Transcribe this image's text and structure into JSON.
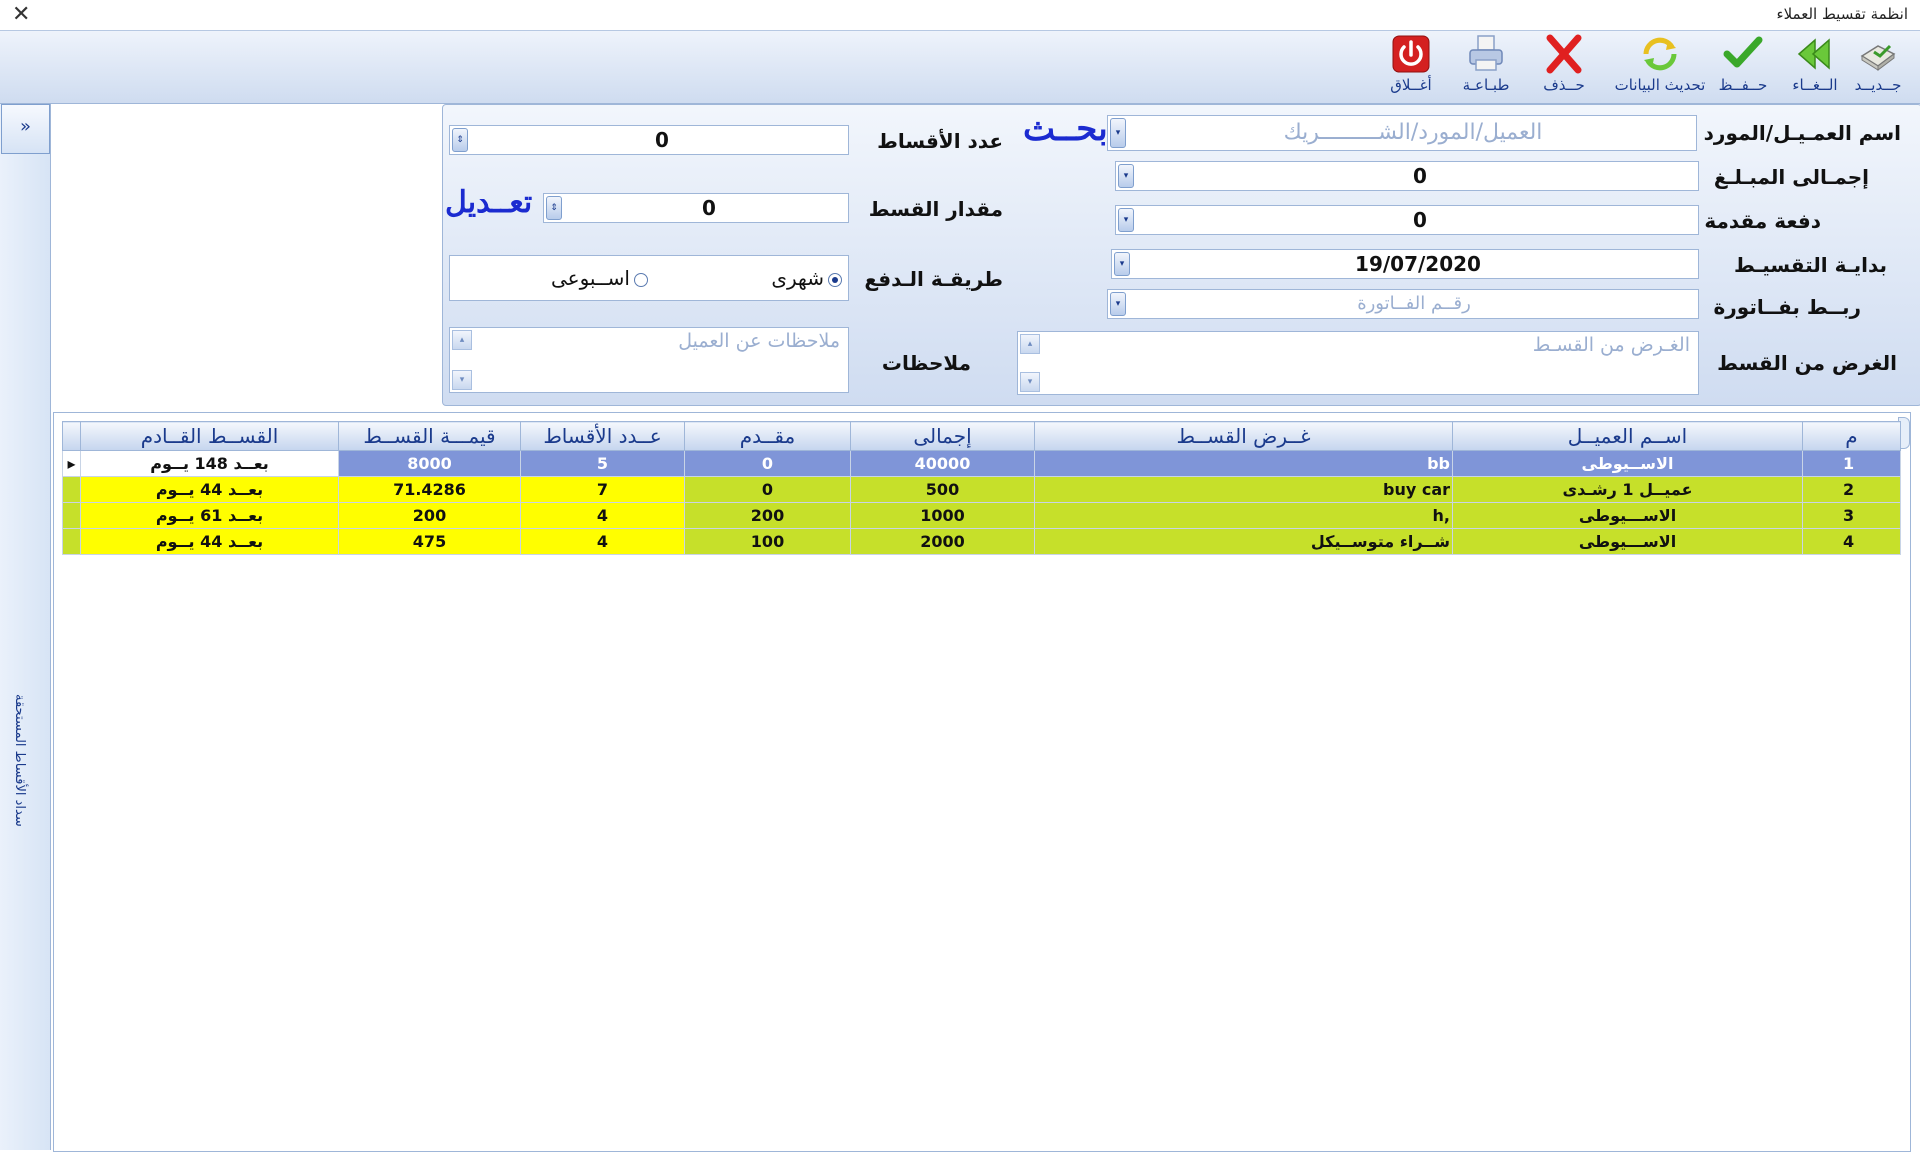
{
  "window": {
    "title": "انظمة تقسيط العملاء",
    "close_icon": "close-icon"
  },
  "toolbar": {
    "new_label": "جــديــد",
    "cancel_label": "الــغــاء",
    "save_label": "حــفــظ",
    "refresh_label": "تحديث البيانات",
    "delete_label": "حــذف",
    "print_label": "طبـاعـة",
    "close_label": "أغــلاق"
  },
  "sidebar": {
    "collapse_label": "»",
    "vertical_text": "سداد الأقساط المستحقة"
  },
  "form": {
    "customer_label": "اسم العمـيـل/المورد",
    "customer_placeholder": "العميل/المورد/الشـــــــــريك",
    "search_link": "بحــث",
    "installments_count_label": "عدد الأقساط",
    "installments_count_value": "0",
    "total_amount_label": "إجمـالى المبـلـغ",
    "total_amount_value": "0",
    "installment_amount_label": "مقدار القسط",
    "installment_amount_value": "0",
    "edit_link": "تعــديل",
    "down_payment_label": "دفعة مقدمة",
    "down_payment_value": "0",
    "start_date_label": "بدايـة التقسيـط",
    "start_date_value": "19/07/2020",
    "payment_method_label": "طريقـة الـدفع",
    "payment_monthly": "شهرى",
    "payment_weekly": "اســبوعى",
    "invoice_link_label": "ربــط بفــاتورة",
    "invoice_placeholder": "رقــم الفــاتورة",
    "purpose_label": "الغرض من القسط",
    "purpose_placeholder": "الغـرض من القسـط",
    "notes_label": "ملاحظات",
    "notes_placeholder": "ملاحظات عن العميل"
  },
  "grid": {
    "headers": {
      "num": "م",
      "customer": "اســم العميــل",
      "purpose": "غــرض القســط",
      "total": "إجمالى",
      "down": "مقــدم",
      "count": "عــدد الأقساط",
      "value": "قيمـــة القســط",
      "next": "القســط القــادم"
    },
    "rows": [
      {
        "num": "1",
        "customer": "الاســيوطى",
        "purpose": "bb",
        "total": "40000",
        "down": "0",
        "count": "5",
        "value": "8000",
        "next": "بعــد 148 يــوم"
      },
      {
        "num": "2",
        "customer": "عميــل 1 رشـدى",
        "purpose": "buy car",
        "total": "500",
        "down": "0",
        "count": "7",
        "value": "71.4286",
        "next": "بعــد 44 يــوم"
      },
      {
        "num": "3",
        "customer": "الاســـيوطى",
        "purpose": "h,",
        "total": "1000",
        "down": "200",
        "count": "4",
        "value": "200",
        "next": "بعــد 61 يــوم"
      },
      {
        "num": "4",
        "customer": "الاســـيوطى",
        "purpose": "شــراء متوســيكل",
        "total": "2000",
        "down": "100",
        "count": "4",
        "value": "475",
        "next": "بعــد 44 يــوم"
      }
    ]
  },
  "colors": {
    "accent": "#1a3a8c",
    "selected_row": "#7f95d8",
    "row_green": "#c6e02a",
    "row_yellow": "#fffe00"
  }
}
